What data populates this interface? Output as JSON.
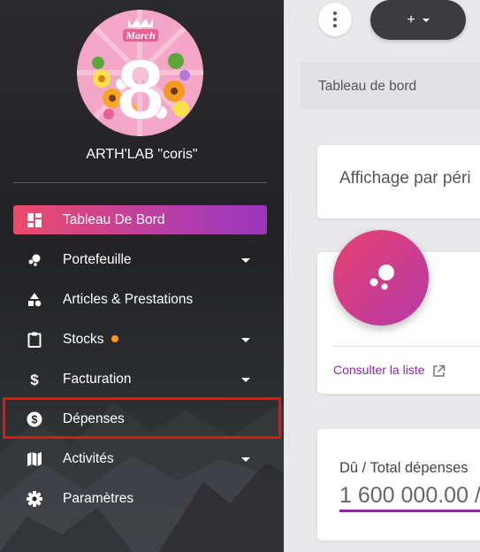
{
  "company_name": "ARTH'LAB \"coris\"",
  "logo": {
    "title": "March",
    "number": "8"
  },
  "sidebar": {
    "items": [
      {
        "label": "Tableau De Bord",
        "icon": "dashboard-icon"
      },
      {
        "label": "Portefeuille",
        "icon": "bubbles-icon"
      },
      {
        "label": "Articles & Prestations",
        "icon": "shapes-icon"
      },
      {
        "label": "Stocks",
        "icon": "clipboard-icon"
      },
      {
        "label": "Facturation",
        "icon": "dollar-icon"
      },
      {
        "label": "Dépenses",
        "icon": "dollar-circle-icon"
      },
      {
        "label": "Activités",
        "icon": "map-icon"
      },
      {
        "label": "Paramètres",
        "icon": "gear-icon"
      }
    ]
  },
  "toolbar": {
    "add_label": "+"
  },
  "breadcrumb": "Tableau de bord",
  "period_card": {
    "text": "Affichage par péri"
  },
  "portfolio_card": {
    "link": "Consulter la liste"
  },
  "expenses_card": {
    "label": "Dû / Total dépenses",
    "amount": "1 600 000.00 /"
  },
  "colors": {
    "accent": "#8e2a9d",
    "active_start": "#ec4a6a",
    "active_end": "#9b35bd",
    "highlight": "#ef1111",
    "notification_dot": "#ff9800"
  }
}
